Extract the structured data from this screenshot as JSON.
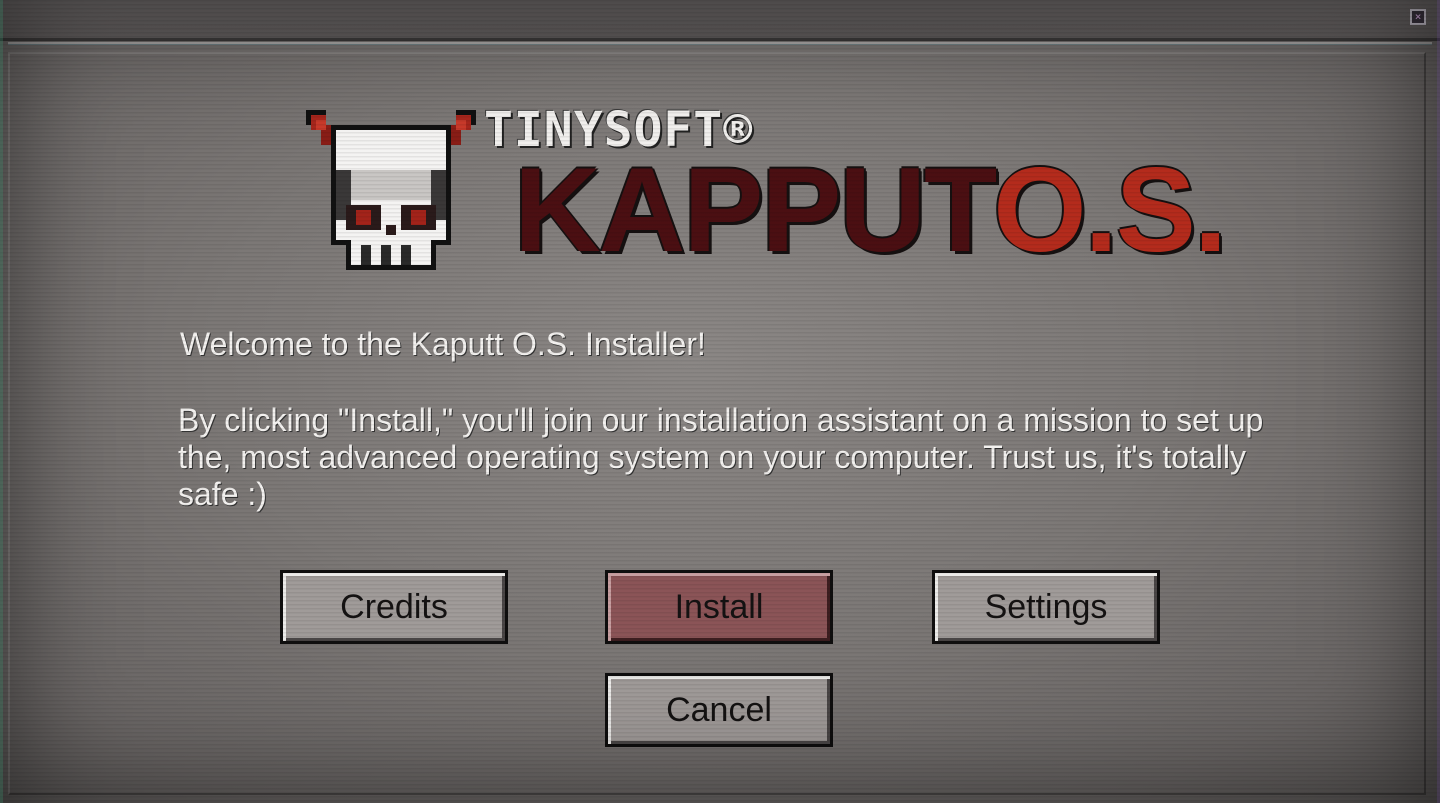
{
  "window": {
    "close_glyph": "×"
  },
  "logo": {
    "brand": "TINYSOFT®",
    "product_main": "KAPPUT",
    "product_suffix": "O.S."
  },
  "content": {
    "welcome": "Welcome to the Kaputt O.S. Installer!",
    "description": "By clicking \"Install,\" you'll join our installation assistant on a mission to set up the, most advanced operating system on your computer. Trust us, it's totally safe :)"
  },
  "buttons": {
    "credits": "Credits",
    "install": "Install",
    "settings": "Settings",
    "cancel": "Cancel"
  },
  "colors": {
    "install_button": "#8b5457",
    "logo_dark_red": "#4b0f12",
    "logo_red": "#b42b1c"
  }
}
